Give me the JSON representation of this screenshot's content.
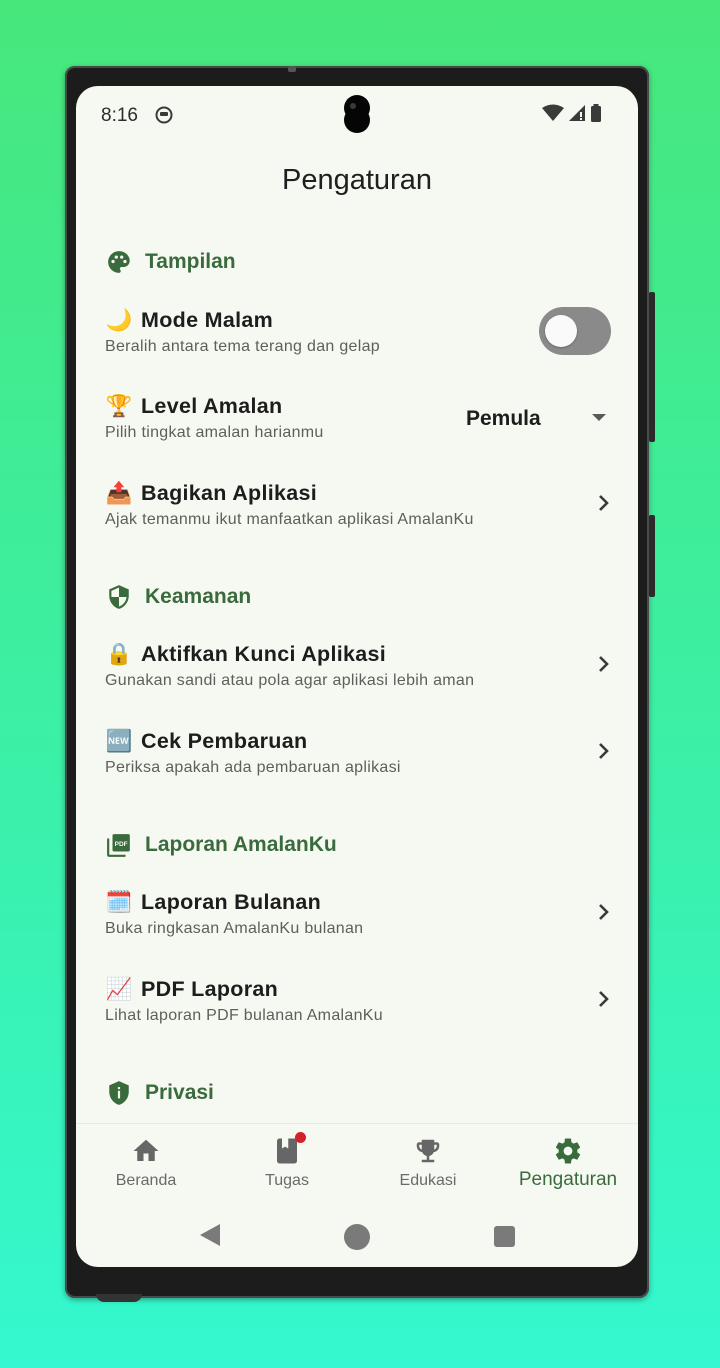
{
  "statusbar": {
    "time": "8:16"
  },
  "page": {
    "title": "Pengaturan"
  },
  "sections": {
    "tampilan": "Tampilan",
    "keamanan": "Keamanan",
    "laporan": "Laporan AmalanKu",
    "privasi": "Privasi"
  },
  "items": {
    "mode_malam": {
      "emoji": "🌙",
      "title": "Mode Malam",
      "subtitle": "Beralih antara tema terang dan gelap",
      "enabled": false
    },
    "level_amalan": {
      "emoji": "🏆",
      "title": "Level Amalan",
      "subtitle": "Pilih tingkat amalan harianmu",
      "value": "Pemula"
    },
    "bagikan": {
      "emoji": "📤",
      "title": "Bagikan Aplikasi",
      "subtitle": "Ajak temanmu ikut manfaatkan aplikasi AmalanKu"
    },
    "kunci": {
      "emoji": "🔒",
      "title": "Aktifkan Kunci Aplikasi",
      "subtitle": "Gunakan sandi atau pola agar aplikasi lebih aman"
    },
    "pembaruan": {
      "emoji": "🆕",
      "title": "Cek Pembaruan",
      "subtitle": "Periksa apakah ada pembaruan aplikasi"
    },
    "laporan_bulanan": {
      "emoji": "🗓️",
      "title": "Laporan Bulanan",
      "subtitle": "Buka ringkasan AmalanKu bulanan"
    },
    "pdf_laporan": {
      "emoji": "📈",
      "title": "PDF Laporan",
      "subtitle": "Lihat laporan PDF bulanan AmalanKu"
    }
  },
  "nav": {
    "beranda": "Beranda",
    "tugas": "Tugas",
    "edukasi": "Edukasi",
    "pengaturan": "Pengaturan"
  },
  "colors": {
    "accent": "#3a6b3c",
    "background": "#f6f9f1",
    "badge": "#d0232a"
  }
}
